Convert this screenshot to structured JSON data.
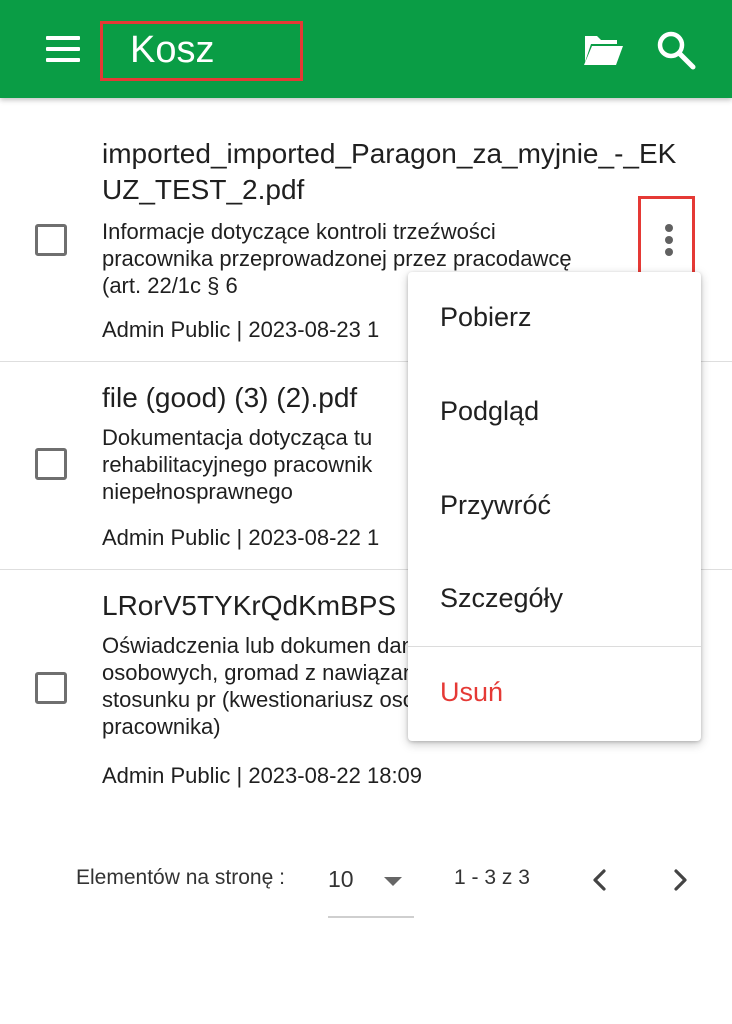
{
  "header": {
    "title": "Kosz",
    "menu_icon": "hamburger-menu-icon",
    "folder_icon": "folder-open-icon",
    "search_icon": "search-icon",
    "background_color": "#0a9d45",
    "highlight_color": "#e53935"
  },
  "files": [
    {
      "name": "imported_imported_Paragon_za_myjnie_-_EKUZ_TEST_2.pdf",
      "description": "Informacje dotyczące kontroli trzeźwości pracownika przeprowadzonej przez pracodawcę (art. 22/1c § 6",
      "meta": "Admin Public | 2023-08-23 1"
    },
    {
      "name": "file (good) (3) (2).pdf",
      "description": "Dokumentacja dotycząca tu rehabilitacyjnego pracownik niepełnosprawnego",
      "meta": "Admin Public | 2023-08-22 1"
    },
    {
      "name": "LRorV5TYKrQdKmBPS",
      "description": "Oświadczenia lub dokumen danych osobowych, gromad z nawiązaniem stosunku pr (kwestionariusz osobowy pracownika)",
      "meta": "Admin Public | 2023-08-22 18:09"
    }
  ],
  "context_menu": {
    "items": [
      "Pobierz",
      "Podgląd",
      "Przywróć",
      "Szczegóły"
    ],
    "danger_item": "Usuń",
    "danger_color": "#e53935"
  },
  "pagination": {
    "items_per_page_label": "Elementów na stronę :",
    "items_per_page_value": "10",
    "range_label": "1 - 3 z 3"
  }
}
